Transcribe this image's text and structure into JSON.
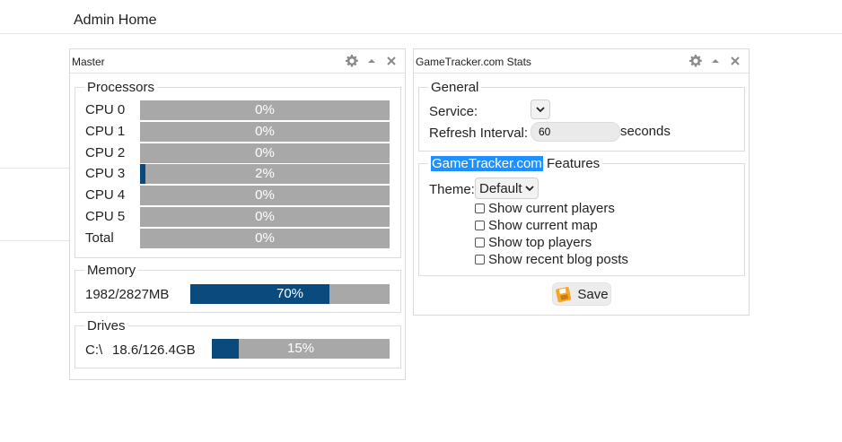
{
  "page": {
    "title": "Admin Home"
  },
  "master": {
    "title": "Master",
    "processors": {
      "legend": "Processors",
      "cpus": [
        {
          "label": "CPU 0",
          "text": "0%",
          "value": 0
        },
        {
          "label": "CPU 1",
          "text": "0%",
          "value": 0
        },
        {
          "label": "CPU 2",
          "text": "0%",
          "value": 0
        },
        {
          "label": "CPU 3",
          "text": "2%",
          "value": 0.02
        },
        {
          "label": "CPU 4",
          "text": "0%",
          "value": 0
        },
        {
          "label": "CPU 5",
          "text": "0%",
          "value": 0
        },
        {
          "label": "Total",
          "text": "0%",
          "value": 0
        }
      ]
    },
    "memory": {
      "legend": "Memory",
      "label": "1982/2827MB",
      "text": "70%",
      "value": 0.7
    },
    "drives": {
      "legend": "Drives",
      "drive": "C:\\",
      "usage": "18.6/126.4GB",
      "text": "15%",
      "value": 0.15
    }
  },
  "gametracker": {
    "title": "GameTracker.com Stats",
    "general": {
      "legend": "General",
      "service_label": "Service:",
      "refresh_label": "Refresh Interval:",
      "refresh_value": "60",
      "refresh_unit": "seconds"
    },
    "features": {
      "legend_link": "GameTracker.com",
      "legend_suffix": " Features",
      "theme_label": "Theme:",
      "theme_value": "Default",
      "options": [
        "Show current players",
        "Show current map",
        "Show top players",
        "Show recent blog posts"
      ]
    },
    "save_label": "Save"
  },
  "colors": {
    "bar_fill": "#0a4a7d",
    "bar_bg": "#a8a8a8",
    "highlight": "#1e90ff"
  }
}
